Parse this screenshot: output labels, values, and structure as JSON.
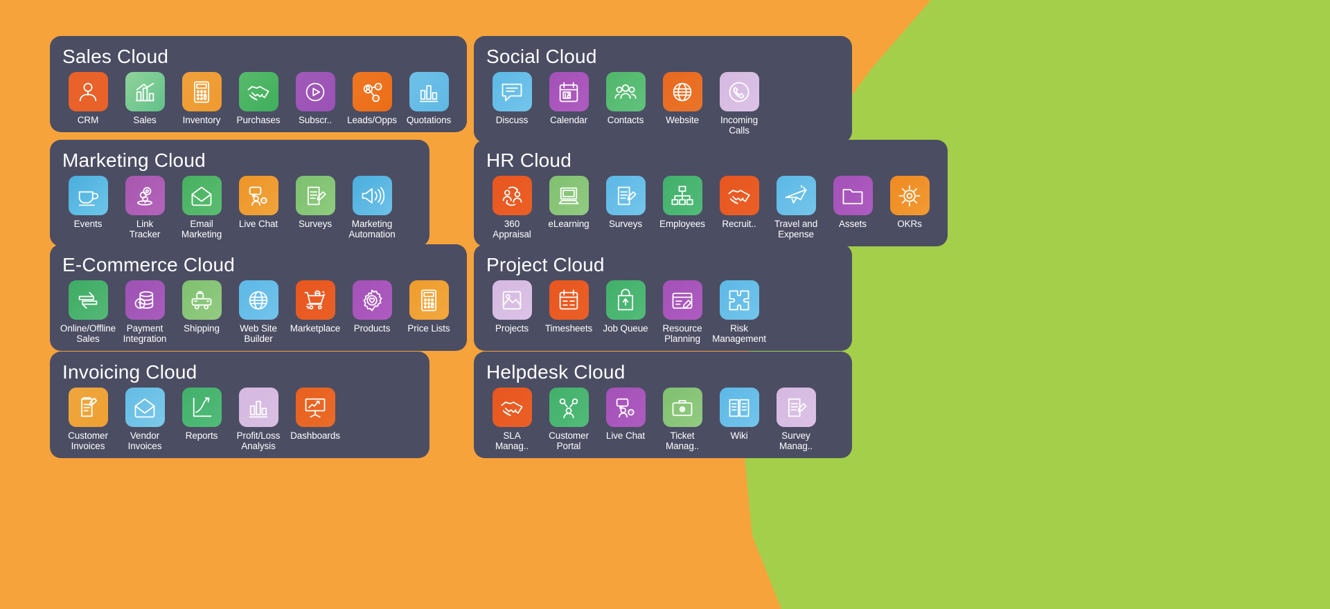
{
  "background": {
    "left_color": "#f7a33c",
    "right_color": "#a4cf4a",
    "card_color": "#4b4d63"
  },
  "columns": [
    {
      "name": "left-column",
      "cards": [
        {
          "title": "Sales Cloud",
          "apps": [
            {
              "label": "CRM",
              "icon": "crm-icon",
              "color1": "#e8622a",
              "color2": "#e8622a"
            },
            {
              "label": "Sales",
              "icon": "sales-chart-icon",
              "color1": "#8fd39a",
              "color2": "#62c18a"
            },
            {
              "label": "Inventory",
              "icon": "calculator-icon",
              "color1": "#f0a13c",
              "color2": "#ee9a2f"
            },
            {
              "label": "Purchases",
              "icon": "handshake-icon",
              "color1": "#57bb6a",
              "color2": "#3fae5c"
            },
            {
              "label": "Subscr..",
              "icon": "play-circle-icon",
              "color1": "#a05ab8",
              "color2": "#9a52b5"
            },
            {
              "label": "Leads/Opps",
              "icon": "leads-network-icon",
              "color1": "#ef7722",
              "color2": "#ec6d18"
            },
            {
              "label": "Quotations",
              "icon": "bar-chart-icon",
              "color1": "#6ec1e8",
              "color2": "#5fb8e4"
            }
          ]
        },
        {
          "title": "Marketing Cloud",
          "apps": [
            {
              "label": "Events",
              "icon": "coffee-cup-icon",
              "color1": "#4aaede",
              "color2": "#6ec6e8"
            },
            {
              "label": "Link\nTracker",
              "icon": "link-tracker-icon",
              "color1": "#a757ad",
              "color2": "#b464bb"
            },
            {
              "label": "Email\nMarketing",
              "icon": "envelope-open-icon",
              "color1": "#46b05f",
              "color2": "#5cbd72"
            },
            {
              "label": "Live Chat",
              "icon": "live-chat-icon",
              "color1": "#ee9427",
              "color2": "#f0a43c"
            },
            {
              "label": "Surveys",
              "icon": "survey-pen-icon",
              "color1": "#7cc06e",
              "color2": "#8fcb7e"
            },
            {
              "label": "Marketing\nAutomation",
              "icon": "megaphone-icon",
              "color1": "#4aaede",
              "color2": "#6ec2e8"
            }
          ]
        },
        {
          "title": "E-Commerce Cloud",
          "apps": [
            {
              "label": "Online/Offline\nSales",
              "icon": "exchange-arrows-icon",
              "color1": "#3dab63",
              "color2": "#55b877"
            },
            {
              "label": "Payment\nIntegration",
              "icon": "coins-icon",
              "color1": "#9d52b3",
              "color2": "#a85dbc"
            },
            {
              "label": "Shipping",
              "icon": "delivery-truck-icon",
              "color1": "#7fc06f",
              "color2": "#93cb82"
            },
            {
              "label": "Web Site\nBuilder",
              "icon": "globe-icon",
              "color1": "#5cb8e6",
              "color2": "#73c4ea"
            },
            {
              "label": "Marketplace",
              "icon": "shopping-cart-icon",
              "color1": "#e8561f",
              "color2": "#ea6026"
            },
            {
              "label": "Products",
              "icon": "gear-heart-icon",
              "color1": "#a451b8",
              "color2": "#ae5cc0"
            },
            {
              "label": "Price Lists",
              "icon": "calculator-icon",
              "color1": "#ef9c2c",
              "color2": "#f2a83e"
            }
          ]
        },
        {
          "title": "Invoicing Cloud",
          "apps": [
            {
              "label": "Customer\nInvoices",
              "icon": "invoice-pen-icon",
              "color1": "#f0a63e",
              "color2": "#eda132"
            },
            {
              "label": "Vendor\nInvoices",
              "icon": "envelope-open-icon",
              "color1": "#64bce4",
              "color2": "#7cc9ea"
            },
            {
              "label": "Reports",
              "icon": "growth-arrow-icon",
              "color1": "#41b06a",
              "color2": "#52bb79"
            },
            {
              "label": "Profit/Loss\nAnalysis",
              "icon": "bar-chart-icon",
              "color1": "#d5b8e0",
              "color2": "#d9bfe3"
            },
            {
              "label": "Dashboards",
              "icon": "presentation-icon",
              "color1": "#e8601f",
              "color2": "#ea6b28"
            }
          ]
        }
      ]
    },
    {
      "name": "right-column",
      "cards": [
        {
          "title": "Social Cloud",
          "apps": [
            {
              "label": "Discuss",
              "icon": "chat-bubble-icon",
              "color1": "#5cb8e6",
              "color2": "#74c5ea"
            },
            {
              "label": "Calendar",
              "icon": "calendar-icon",
              "color1": "#a451b8",
              "color2": "#ae5cc0"
            },
            {
              "label": "Contacts",
              "icon": "contacts-icon",
              "color1": "#50b76a",
              "color2": "#62c27c"
            },
            {
              "label": "Website",
              "icon": "globe-icon",
              "color1": "#e8691f",
              "color2": "#ea7428"
            },
            {
              "label": "Incoming\nCalls",
              "icon": "incoming-call-icon",
              "color1": "#d5b8e0",
              "color2": "#dcc3e6"
            }
          ]
        },
        {
          "title": "HR Cloud",
          "apps": [
            {
              "label": "360\nAppraisal",
              "icon": "appraisal-icon",
              "color1": "#e8561f",
              "color2": "#ea6026"
            },
            {
              "label": "eLearning",
              "icon": "monitor-icon",
              "color1": "#7fc06f",
              "color2": "#93cb82"
            },
            {
              "label": "Surveys",
              "icon": "survey-pen-icon",
              "color1": "#5cb8e6",
              "color2": "#74c5ea"
            },
            {
              "label": "Employees",
              "icon": "org-chart-icon",
              "color1": "#41b06a",
              "color2": "#52bb79"
            },
            {
              "label": "Recruit..",
              "icon": "handshake-icon",
              "color1": "#e8561f",
              "color2": "#ea6026"
            },
            {
              "label": "Travel and\nExpense",
              "icon": "airplane-icon",
              "color1": "#5cb8e6",
              "color2": "#74c5ea"
            },
            {
              "label": "Assets",
              "icon": "folder-icon",
              "color1": "#a451b8",
              "color2": "#ae5cc0"
            },
            {
              "label": "OKRs",
              "icon": "target-sun-icon",
              "color1": "#ef8a22",
              "color2": "#f29a33"
            }
          ]
        },
        {
          "title": "Project Cloud",
          "apps": [
            {
              "label": "Projects",
              "icon": "projects-icon",
              "color1": "#d5b8e0",
              "color2": "#dcc3e6"
            },
            {
              "label": "Timesheets",
              "icon": "timesheet-icon",
              "color1": "#e8561f",
              "color2": "#ea6026"
            },
            {
              "label": "Job Queue",
              "icon": "job-queue-icon",
              "color1": "#41b06a",
              "color2": "#52bb79"
            },
            {
              "label": "Resource\nPlanning",
              "icon": "resource-plan-icon",
              "color1": "#a451b8",
              "color2": "#ae5cc0"
            },
            {
              "label": "Risk\nManagement",
              "icon": "risk-puzzle-icon",
              "color1": "#5cb8e6",
              "color2": "#74c5ea"
            }
          ]
        },
        {
          "title": "Helpdesk Cloud",
          "apps": [
            {
              "label": "SLA\nManag..",
              "icon": "handshake-icon",
              "color1": "#e8561f",
              "color2": "#ea6026"
            },
            {
              "label": "Customer\nPortal",
              "icon": "customer-portal-icon",
              "color1": "#41b06a",
              "color2": "#52bb79"
            },
            {
              "label": "Live Chat",
              "icon": "live-chat-icon",
              "color1": "#a451b8",
              "color2": "#ae5cc0"
            },
            {
              "label": "Ticket\nManag..",
              "icon": "ticket-case-icon",
              "color1": "#7fc06f",
              "color2": "#93cb82"
            },
            {
              "label": "Wiki",
              "icon": "book-icon",
              "color1": "#5cb8e6",
              "color2": "#74c5ea"
            },
            {
              "label": "Survey\nManag..",
              "icon": "survey-pen-icon",
              "color1": "#d5b8e0",
              "color2": "#dcc3e6"
            }
          ]
        }
      ]
    }
  ]
}
